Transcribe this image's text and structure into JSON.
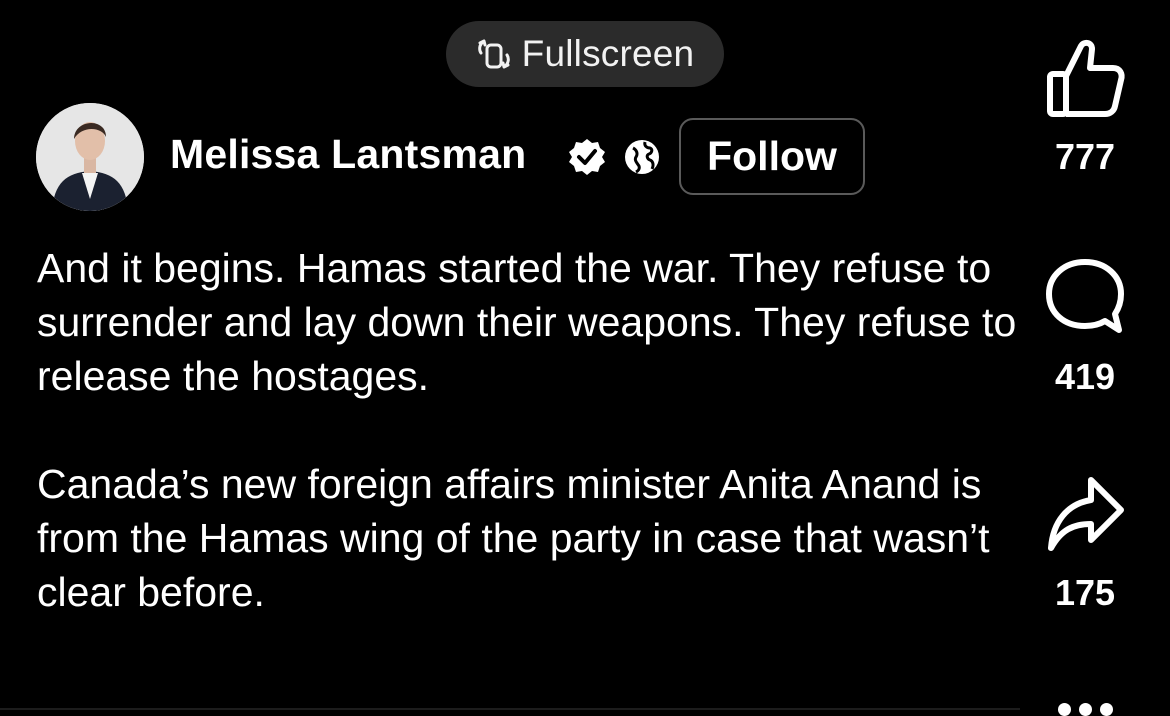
{
  "toolbar": {
    "fullscreen_label": "Fullscreen",
    "fullscreen_icon": "fullscreen-icon"
  },
  "author": {
    "name": "Melissa Lantsman",
    "verified_icon": "verified-badge-icon",
    "visibility_icon": "globe-icon",
    "follow_label": "Follow"
  },
  "post": {
    "paragraph_1": "And it begins. Hamas started the war. They refuse to surrender and lay down their weapons. They refuse to release the hostages.",
    "paragraph_2": "Canada’s new foreign affairs minister Anita Anand is from the Hamas wing of the party in case that wasn’t clear before."
  },
  "actions": {
    "like_count": "777",
    "comment_count": "419",
    "share_count": "175",
    "like_icon": "thumbs-up-icon",
    "comment_icon": "comment-bubble-icon",
    "share_icon": "share-arrow-icon",
    "more_icon": "more-dots-icon"
  },
  "colors": {
    "background": "#000000",
    "pill": "#2b2b2b",
    "text": "#ffffff",
    "button_border": "#5a5a5a"
  }
}
